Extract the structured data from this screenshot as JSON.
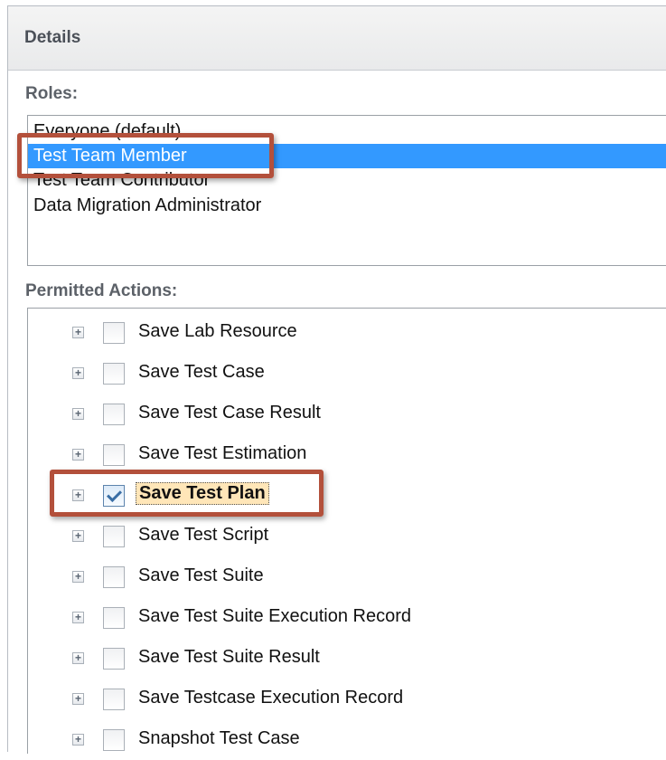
{
  "panel": {
    "title": "Details"
  },
  "roles": {
    "label": "Roles:",
    "items": [
      {
        "label": "Everyone (default)",
        "selected": false
      },
      {
        "label": "Test Team Member",
        "selected": true
      },
      {
        "label": "Test Team Contributor",
        "selected": false
      },
      {
        "label": "Data Migration Administrator",
        "selected": false
      }
    ]
  },
  "actions": {
    "label": "Permitted Actions:",
    "expander_glyph": "+",
    "items": [
      {
        "label": "Save Lab Resource",
        "checked": false
      },
      {
        "label": "Save Test Case",
        "checked": false
      },
      {
        "label": "Save Test Case Result",
        "checked": false
      },
      {
        "label": "Save Test Estimation",
        "checked": false
      },
      {
        "label": "Save Test Plan",
        "checked": true
      },
      {
        "label": "Save Test Script",
        "checked": false
      },
      {
        "label": "Save Test Suite",
        "checked": false
      },
      {
        "label": "Save Test Suite Execution Record",
        "checked": false
      },
      {
        "label": "Save Test Suite Result",
        "checked": false
      },
      {
        "label": "Save Testcase Execution Record",
        "checked": false
      },
      {
        "label": "Snapshot Test Case",
        "checked": false
      }
    ]
  },
  "colors": {
    "selection": "#3399ff",
    "highlight_border": "#b3503b",
    "active_item_bg": "#ffe6b8"
  }
}
